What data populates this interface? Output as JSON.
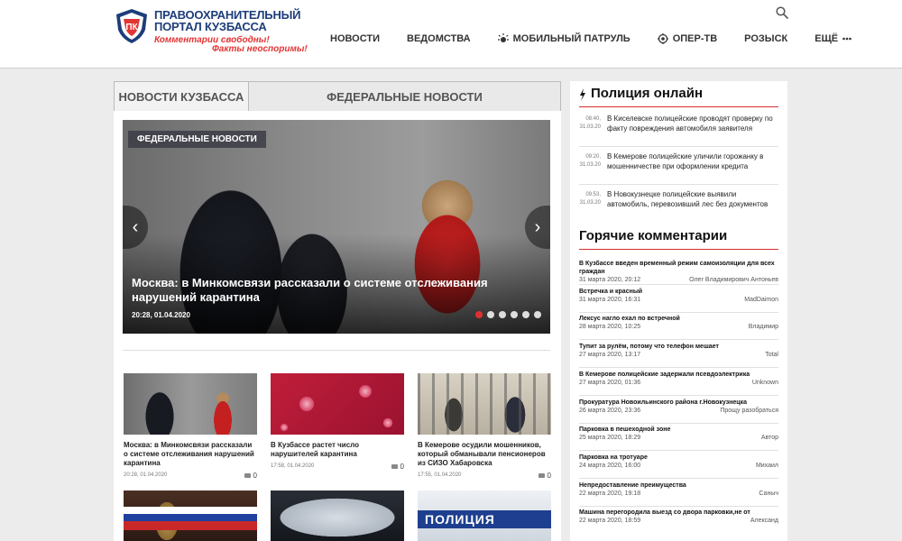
{
  "header": {
    "logo_mark": "ПК",
    "logo_line1": "ПРАВООХРАНИТЕЛЬНЫЙ",
    "logo_line2": "ПОРТАЛ КУЗБАССА",
    "slogan1": "Комментарии свободны!",
    "slogan2": "Факты неоспоримы!",
    "nav": [
      "НОВОСТИ",
      "ВЕДОМСТВА",
      "МОБИЛЬНЫЙ ПАТРУЛЬ",
      "ОПЕР-ТВ",
      "РОЗЫСК",
      "ЕЩЁ"
    ],
    "icons": {
      "search": "search-icon",
      "patrol": "siren-icon",
      "opertv": "target-icon",
      "more": "more-dots-icon"
    }
  },
  "tabs": [
    "НОВОСТИ КУЗБАССА",
    "ФЕДЕРАЛЬНЫЕ НОВОСТИ"
  ],
  "slider": {
    "badge": "ФЕДЕРАЛЬНЫЕ НОВОСТИ",
    "title": "Москва: в Минкомсвязи рассказали о системе отслеживания нарушений карантина",
    "time": "20:28, 01.04.2020",
    "dot_count": 6,
    "active_dot": 1
  },
  "cards": [
    {
      "title": "Москва: в Минкомсвязи рассказали о системе отслеживания нарушений карантина",
      "time": "20:28, 01.04.2020",
      "comments": "0"
    },
    {
      "title": "В Кузбассе растет число нарушителей карантина",
      "time": "17:58, 01.04.2020",
      "comments": "0"
    },
    {
      "title": "В Кемерове осудили мошенников, который обманывали пенсионеров из СИЗО Хабаровска",
      "time": "17:55, 01.04.2020",
      "comments": "0"
    },
    {
      "title": "",
      "time": "",
      "comments": ""
    },
    {
      "title": "",
      "time": "",
      "comments": ""
    },
    {
      "title": "",
      "time": "",
      "comments": ""
    }
  ],
  "police_online": {
    "heading": "Полиция онлайн",
    "items": [
      {
        "time": "08:40,",
        "date": "31.03.20",
        "text": "В Киселевске полицейские проводят проверку по факту повреждения автомобиля заявителя"
      },
      {
        "time": "09:20,",
        "date": "31.03.20",
        "text": "В Кемерове полицейские уличили горожанку в мошенничестве при оформлении кредита"
      },
      {
        "time": "09:53,",
        "date": "31.03.20",
        "text": "В Новокузнецке полицейские выявили автомобиль, перевозивший лес без документов"
      }
    ]
  },
  "hot_comments": {
    "heading": "Горячие комментарии",
    "items": [
      {
        "title": "В Кузбассе введен временный режим самоизоляции для всех граждан",
        "date": "31 марта 2020, 20:12",
        "author": "Олег Владимирович Антоньев"
      },
      {
        "title": "Встречка и красный",
        "date": "31 марта 2020, 16:31",
        "author": "MadDaimon"
      },
      {
        "title": "Лексус нагло ехал по встречной",
        "date": "28 марта 2020, 10:25",
        "author": "Владимир"
      },
      {
        "title": "Тупит за рулём, потому что телефон мешает",
        "date": "27 марта 2020, 13:17",
        "author": "Total"
      },
      {
        "title": "В Кемерове полицейские задержали псевдоэлектрика",
        "date": "27 марта 2020, 01:36",
        "author": "Unknown"
      },
      {
        "title": "Прокуратура Новоильинского района г.Новокузнецка",
        "date": "26 марта 2020, 23:36",
        "author": "Прощу разобраться"
      },
      {
        "title": "Парковка в пешеходной зоне",
        "date": "25 марта 2020, 18:29",
        "author": "Автор"
      },
      {
        "title": "Парковка на тротуаре",
        "date": "24 марта 2020, 16:00",
        "author": "Михаил"
      },
      {
        "title": "Непредоставление преимущества",
        "date": "22 марта 2020, 19:18",
        "author": "Саныч"
      },
      {
        "title": "Машина перегородила выезд со двора парковки,не от",
        "date": "22 марта 2020, 18:59",
        "author": "Александ"
      }
    ]
  },
  "colors": {
    "brand_blue": "#1d3d7a",
    "accent_red": "#e23535"
  }
}
